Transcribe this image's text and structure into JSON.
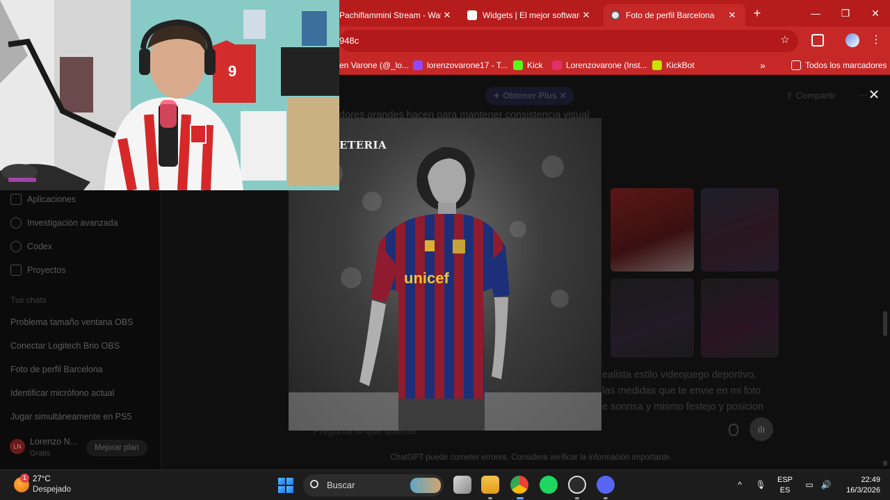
{
  "browser": {
    "tabs": [
      {
        "title": "Pachiflammini Stream - Wat",
        "active": false
      },
      {
        "title": "Widgets | El mejor software",
        "active": false
      },
      {
        "title": "Foto de perfil Barcelona",
        "active": true
      }
    ],
    "new_tab_label": "+",
    "window_controls": {
      "minimize": "—",
      "restore": "❐",
      "close": "✕"
    },
    "address": "948c",
    "bookmarks": [
      {
        "label": "en Varone (@_lo...",
        "color": "#ffffff"
      },
      {
        "label": "lorenzovarone17 - T...",
        "color": "#9146ff"
      },
      {
        "label": "Kick",
        "color": "#53fc18"
      },
      {
        "label": "Lorenzovarone (Inst...",
        "color": "#e1306c"
      },
      {
        "label": "KickBot",
        "color": "#c6e400"
      }
    ],
    "bookmarks_overflow": "»",
    "all_bookmarks": "Todos los marcadores"
  },
  "chatgpt": {
    "sidebar": {
      "items": [
        {
          "label": "Aplicaciones",
          "icon": "apps-icon"
        },
        {
          "label": "Investigación avanzada",
          "icon": "telescope-icon"
        },
        {
          "label": "Codex",
          "icon": "codex-icon"
        },
        {
          "label": "Proyectos",
          "icon": "folder-icon"
        }
      ],
      "section_title": "Tus chats",
      "chats": [
        "Problema tamaño ventana OBS",
        "Conectar Logitech Brio OBS",
        "Foto de perfil Barcelona",
        "Identificar micrófono actual",
        "Jugar simultáneamente en PS5"
      ],
      "user": {
        "initials": "LN",
        "name": "Lorenzo N...",
        "plan": "Gratis"
      },
      "upgrade_label": "Mejorar plan"
    },
    "header": {
      "get_plus": "✦ Obtener Plus ✕",
      "share": "Compartir",
      "more": "···"
    },
    "background_lines": [
      "dores grandes hacen para mantener consistencia visual",
      "ealista estilo videojuego deportivo,",
      "las medidas que te envie en mi foto",
      "e sonrisa y mismo festejo y posicion"
    ],
    "composer_placeholder": "Pregunta lo que quieras",
    "disclaimer": "ChatGPT puede cometer errores. Considera verificar la información importante.",
    "lightbox_close": "✕"
  },
  "photo": {
    "overlay_text": "ETERIA",
    "shirt_text": "unicef"
  },
  "taskbar": {
    "weather": {
      "temp": "27°C",
      "condition": "Despejado",
      "badge": "1"
    },
    "search_label": "Buscar",
    "language": {
      "top": "ESP",
      "bottom": "ES"
    },
    "clock": {
      "time": "22:49",
      "date": "16/3/2026"
    },
    "tray_chevron": "^"
  }
}
